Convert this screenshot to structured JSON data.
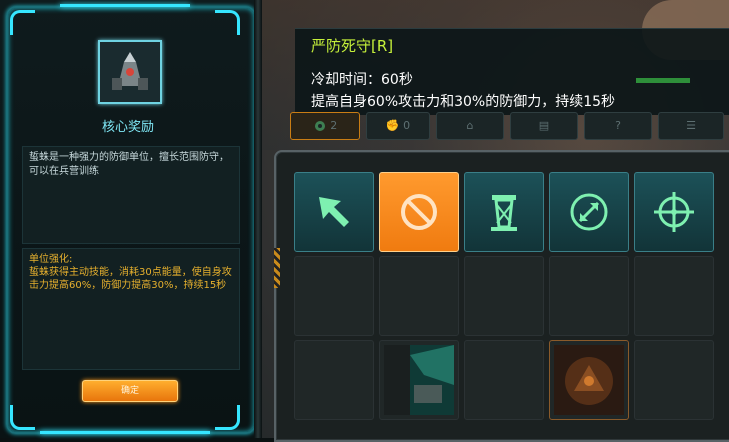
{
  "reward_panel": {
    "title": "核心奖励",
    "description": "蜇蛛是一种强力的防御单位，擅长范围防守，可以在兵营训练",
    "enhance_title": "单位强化:",
    "enhance_text": "蜇蛛获得主动技能，消耗30点能量，使自身攻击力提高60%，防御力提高30%，持续15秒",
    "confirm_label": "确定"
  },
  "tooltip": {
    "title": "严防死守[R]",
    "cooldown": "冷却时间：60秒",
    "description": "提高自身60%攻击力和30%的防御力，持续15秒"
  },
  "top_buttons": [
    {
      "icon": "gear-icon",
      "label": "2"
    },
    {
      "icon": "fist-icon",
      "label": "0"
    },
    {
      "icon": "building-icon",
      "label": ""
    },
    {
      "icon": "book-icon",
      "label": ""
    },
    {
      "icon": "help-icon",
      "label": "?"
    },
    {
      "icon": "list-icon",
      "label": ""
    }
  ],
  "command_grid": {
    "row1": [
      {
        "icon": "move-arrow-icon"
      },
      {
        "icon": "stop-icon"
      },
      {
        "icon": "tower-icon"
      },
      {
        "icon": "defend-shield-icon"
      },
      {
        "icon": "target-crosshair-icon"
      }
    ]
  },
  "colors": {
    "cyan_accent": "#36e6ff",
    "orange_accent": "#f07b10",
    "tooltip_title": "#c5f03a",
    "enhance_text": "#e6b02e"
  }
}
